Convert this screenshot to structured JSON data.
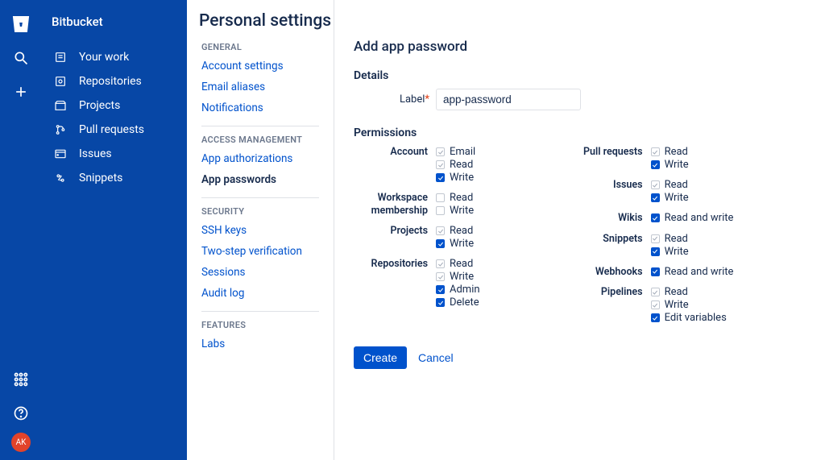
{
  "brand": "Bitbucket",
  "avatar_initials": "AK",
  "nav": {
    "items": [
      {
        "label": "Your work"
      },
      {
        "label": "Repositories"
      },
      {
        "label": "Projects"
      },
      {
        "label": "Pull requests"
      },
      {
        "label": "Issues"
      },
      {
        "label": "Snippets"
      }
    ]
  },
  "page_title": "Personal settings",
  "settings": {
    "groups": [
      {
        "heading": "General",
        "items": [
          {
            "label": "Account settings",
            "active": false
          },
          {
            "label": "Email aliases",
            "active": false
          },
          {
            "label": "Notifications",
            "active": false
          }
        ]
      },
      {
        "heading": "Access Management",
        "items": [
          {
            "label": "App authorizations",
            "active": false
          },
          {
            "label": "App passwords",
            "active": true
          }
        ]
      },
      {
        "heading": "Security",
        "items": [
          {
            "label": "SSH keys",
            "active": false
          },
          {
            "label": "Two-step verification",
            "active": false
          },
          {
            "label": "Sessions",
            "active": false
          },
          {
            "label": "Audit log",
            "active": false
          }
        ]
      },
      {
        "heading": "Features",
        "items": [
          {
            "label": "Labs",
            "active": false
          }
        ]
      }
    ]
  },
  "form": {
    "title": "Add app password",
    "details_heading": "Details",
    "label_field": "Label",
    "label_value": "app-password",
    "permissions_heading": "Permissions",
    "create_btn": "Create",
    "cancel_btn": "Cancel"
  },
  "permissions": {
    "left": [
      {
        "name": "Account",
        "opts": [
          {
            "label": "Email",
            "state": "grey"
          },
          {
            "label": "Read",
            "state": "grey"
          },
          {
            "label": "Write",
            "state": "blue"
          }
        ]
      },
      {
        "name": "Workspace membership",
        "opts": [
          {
            "label": "Read",
            "state": "empty"
          },
          {
            "label": "Write",
            "state": "empty"
          }
        ]
      },
      {
        "name": "Projects",
        "opts": [
          {
            "label": "Read",
            "state": "grey"
          },
          {
            "label": "Write",
            "state": "blue"
          }
        ]
      },
      {
        "name": "Repositories",
        "opts": [
          {
            "label": "Read",
            "state": "grey"
          },
          {
            "label": "Write",
            "state": "grey"
          },
          {
            "label": "Admin",
            "state": "blue"
          },
          {
            "label": "Delete",
            "state": "blue"
          }
        ]
      }
    ],
    "right": [
      {
        "name": "Pull requests",
        "opts": [
          {
            "label": "Read",
            "state": "grey"
          },
          {
            "label": "Write",
            "state": "blue"
          }
        ]
      },
      {
        "name": "Issues",
        "opts": [
          {
            "label": "Read",
            "state": "grey"
          },
          {
            "label": "Write",
            "state": "blue"
          }
        ]
      },
      {
        "name": "Wikis",
        "opts": [
          {
            "label": "Read and write",
            "state": "blue"
          }
        ]
      },
      {
        "name": "Snippets",
        "opts": [
          {
            "label": "Read",
            "state": "grey"
          },
          {
            "label": "Write",
            "state": "blue"
          }
        ]
      },
      {
        "name": "Webhooks",
        "opts": [
          {
            "label": "Read and write",
            "state": "blue"
          }
        ]
      },
      {
        "name": "Pipelines",
        "opts": [
          {
            "label": "Read",
            "state": "grey"
          },
          {
            "label": "Write",
            "state": "grey"
          },
          {
            "label": "Edit variables",
            "state": "blue"
          }
        ]
      }
    ]
  }
}
